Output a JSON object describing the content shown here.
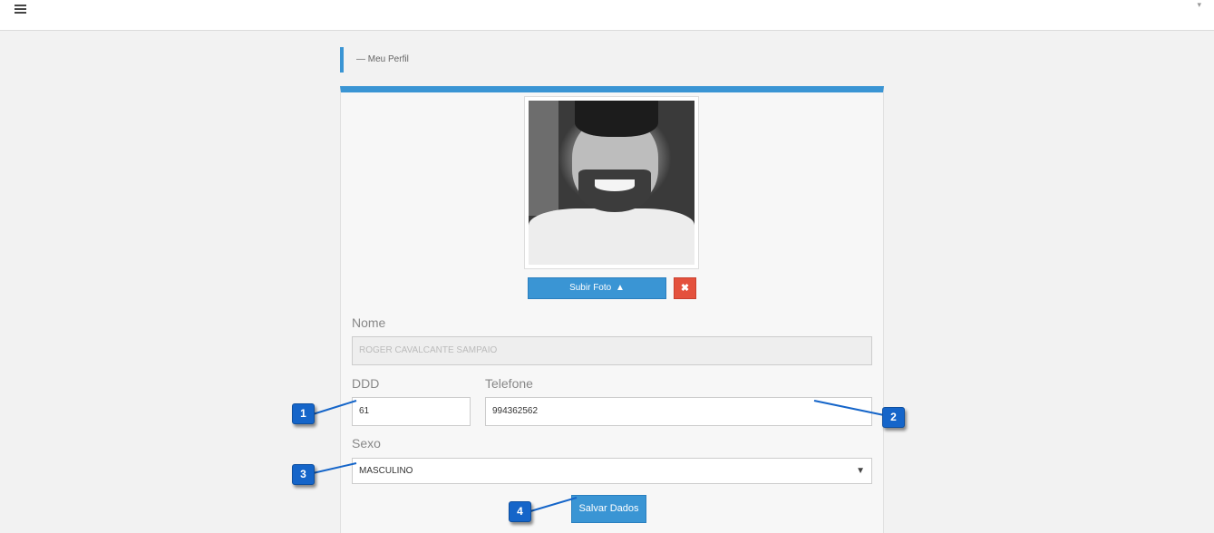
{
  "topbar": {
    "menu_icon": "hamburger-icon",
    "dropdown_icon": "caret-down-icon"
  },
  "breadcrumb": {
    "text": "— Meu Perfil"
  },
  "profile": {
    "upload_button_label": "Subir Foto",
    "upload_icon": "user-upload-icon",
    "remove_icon_glyph": "✖",
    "name_label": "Nome",
    "name_value": "ROGER CAVALCANTE SAMPAIO",
    "ddd_label": "DDD",
    "ddd_value": "61",
    "phone_label": "Telefone",
    "phone_value": "994362562",
    "sex_label": "Sexo",
    "sex_value": "MASCULINO",
    "save_button_label": "Salvar Dados"
  },
  "callouts": [
    "1",
    "2",
    "3",
    "4"
  ],
  "colors": {
    "accent": "#3a95d4",
    "danger": "#e4513d",
    "callout": "#1565c9"
  }
}
